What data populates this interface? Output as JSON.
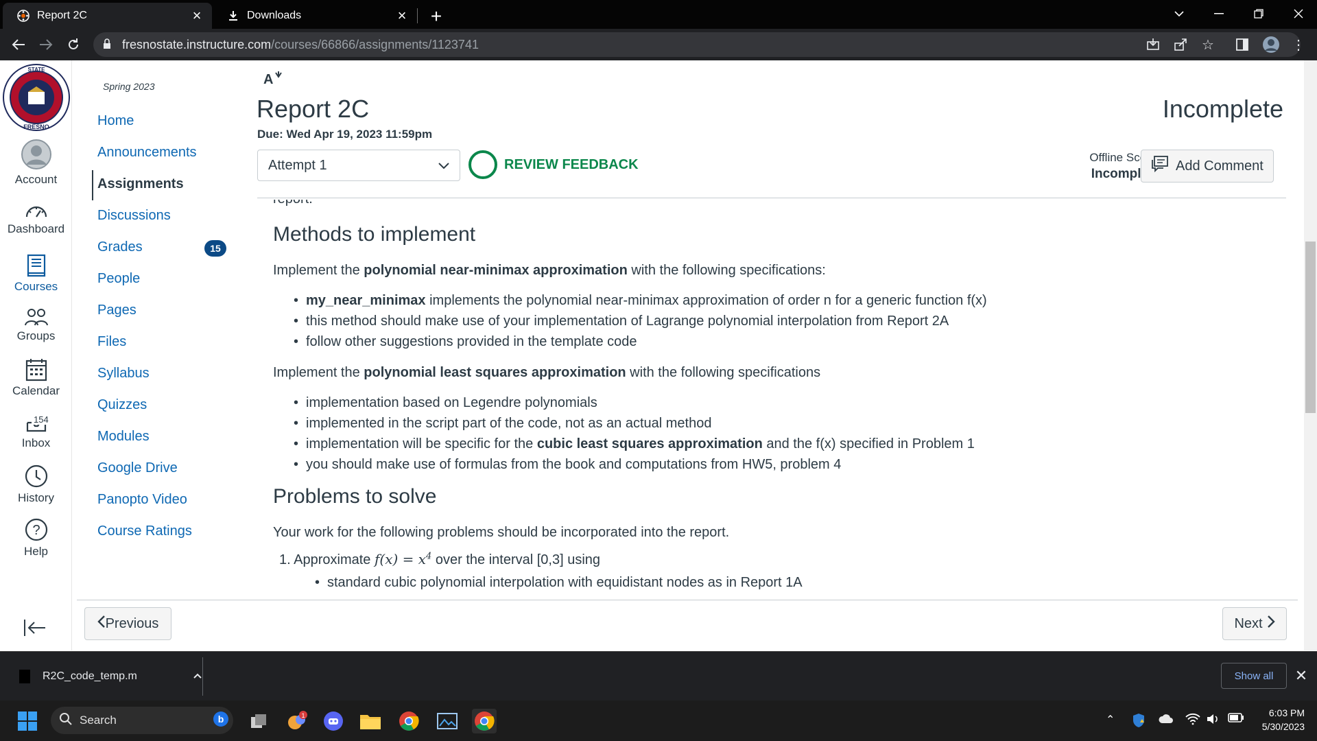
{
  "browser": {
    "tabs": [
      {
        "title": "Report 2C",
        "active": true
      },
      {
        "title": "Downloads",
        "active": false
      }
    ],
    "url_host": "fresnostate.instructure.com",
    "url_path": "/courses/66866/assignments/1123741"
  },
  "global_nav": {
    "items": [
      {
        "label": "Account",
        "icon": "account-avatar-icon"
      },
      {
        "label": "Dashboard",
        "icon": "dashboard-icon"
      },
      {
        "label": "Courses",
        "icon": "courses-icon",
        "active": true
      },
      {
        "label": "Groups",
        "icon": "groups-icon"
      },
      {
        "label": "Calendar",
        "icon": "calendar-icon"
      },
      {
        "label": "Inbox",
        "icon": "inbox-icon",
        "badge": "154"
      },
      {
        "label": "History",
        "icon": "history-icon"
      },
      {
        "label": "Help",
        "icon": "help-icon"
      }
    ]
  },
  "course_nav": {
    "term": "Spring 2023",
    "items": [
      {
        "label": "Home"
      },
      {
        "label": "Announcements"
      },
      {
        "label": "Assignments",
        "active": true
      },
      {
        "label": "Discussions"
      },
      {
        "label": "Grades",
        "badge": "15"
      },
      {
        "label": "People"
      },
      {
        "label": "Pages"
      },
      {
        "label": "Files"
      },
      {
        "label": "Syllabus"
      },
      {
        "label": "Quizzes"
      },
      {
        "label": "Modules"
      },
      {
        "label": "Google Drive"
      },
      {
        "label": "Panopto Video"
      },
      {
        "label": "Course Ratings"
      }
    ]
  },
  "assignment": {
    "title": "Report 2C",
    "due_label": "Due:",
    "due_value": "Wed Apr 19, 2023 11:59pm",
    "grade_status": "Incomplete",
    "attempt": "Attempt 1",
    "review_feedback": "REVIEW FEEDBACK",
    "offline_score_label": "Offline Score:",
    "offline_score_value": "Incomplete",
    "add_comment": "Add Comment"
  },
  "description": {
    "cut_text": "report.",
    "h_methods": "Methods to implement",
    "p_minimax_pre": "Implement the ",
    "p_minimax_bold": "polynomial near-minimax approximation",
    "p_minimax_post": " with the following specifications:",
    "minimax_items": [
      {
        "bold": "my_near_minimax",
        "text": " implements the polynomial near-minimax approximation of order n for a generic function f(x)"
      },
      {
        "bold": "",
        "text": "this method should make use of your implementation of Lagrange polynomial interpolation from Report 2A"
      },
      {
        "bold": "",
        "text": "follow other suggestions provided in the template code"
      }
    ],
    "p_ls_pre": "Implement the ",
    "p_ls_bold": "polynomial least squares approximation",
    "p_ls_post": " with the following specifications",
    "ls_item1": "implementation based on Legendre polynomials",
    "ls_item2": "implemented in the script part of the code, not as an actual method",
    "ls_item3_pre": "implementation will be specific for the ",
    "ls_item3_bold": "cubic least squares approximation",
    "ls_item3_post": " and the f(x) specified in Problem 1",
    "ls_item4": "you should make use of formulas from the book and computations from HW5, problem 4",
    "h_problems": "Problems to solve",
    "p_problems": "Your work for the following problems should be incorporated into the report.",
    "problem1_num": "1.",
    "problem1_pre": "Approximate ",
    "problem1_math_lhs": "f(x)",
    "problem1_math_eq": " = ",
    "problem1_math_rhs": "x",
    "problem1_math_exp": "4",
    "problem1_post": " over the interval [0,3] using",
    "problem1_sub1": "standard cubic polynomial interpolation with equidistant nodes as in Report 1A"
  },
  "pager": {
    "previous": "Previous",
    "next": "Next"
  },
  "downloads": {
    "file": "R2C_code_temp.m",
    "show_all": "Show all"
  },
  "taskbar": {
    "search": "Search",
    "time": "6:03 PM",
    "date": "5/30/2023",
    "teams_badge": "1"
  }
}
